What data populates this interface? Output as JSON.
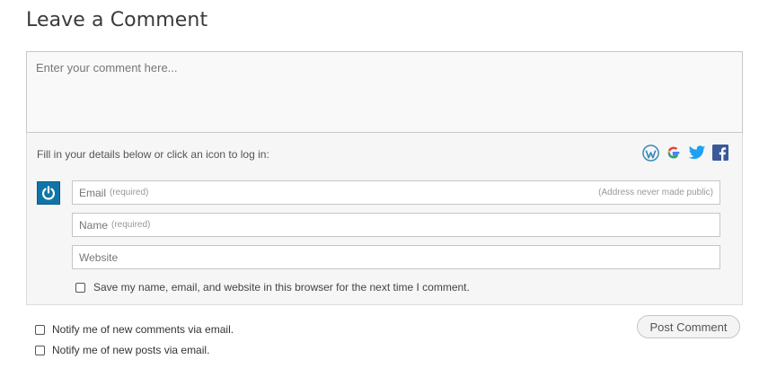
{
  "heading": "Leave a Comment",
  "comment": {
    "placeholder": "Enter your comment here..."
  },
  "details": {
    "prompt": "Fill in your details below or click an icon to log in:",
    "social_icons": [
      "wordpress-icon",
      "google-icon",
      "twitter-icon",
      "facebook-icon"
    ],
    "email": {
      "label": "Email",
      "required": "(required)",
      "note": "(Address never made public)"
    },
    "name": {
      "label": "Name",
      "required": "(required)"
    },
    "website": {
      "label": "Website"
    },
    "save_label": "Save my name, email, and website in this browser for the next time I comment."
  },
  "notify": {
    "comments_label": "Notify me of new comments via email.",
    "posts_label": "Notify me of new posts via email."
  },
  "post_button": "Post Comment",
  "colors": {
    "wordpress": "#3c8ab8",
    "twitter": "#1da1f2",
    "facebook": "#3b5998",
    "gravatar": "#0f75a8"
  }
}
